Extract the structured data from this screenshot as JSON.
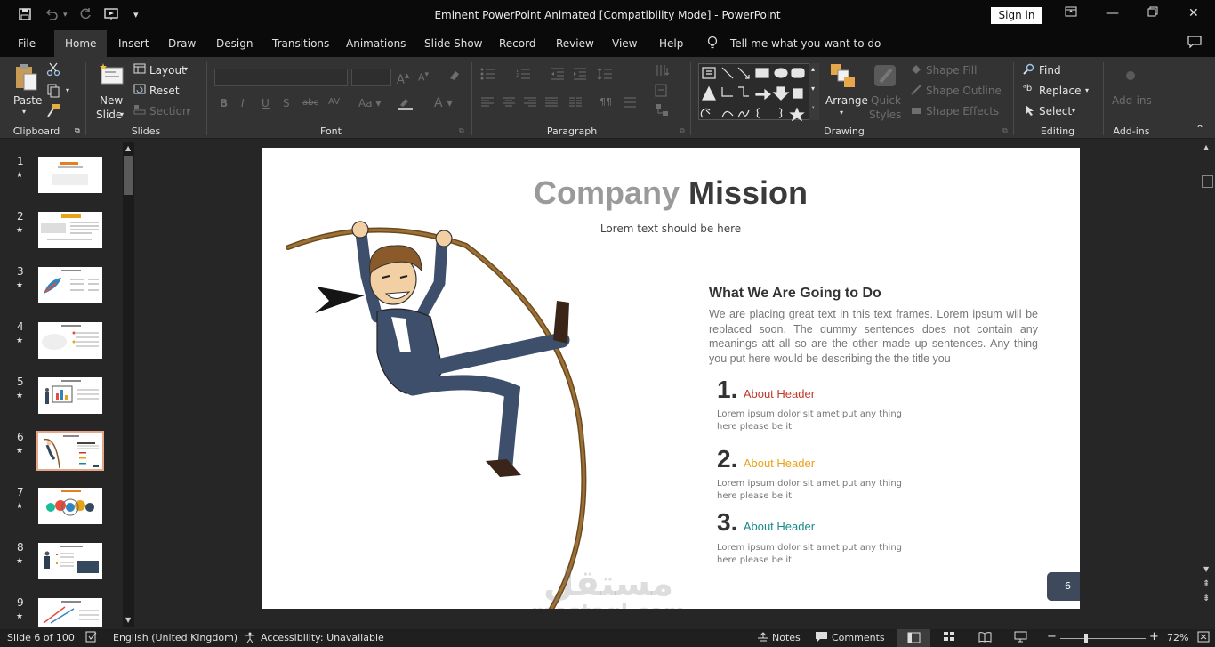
{
  "window": {
    "title": "Eminent PowerPoint Animated [Compatibility Mode]  -  PowerPoint",
    "sign_in": "Sign in"
  },
  "tabs": [
    {
      "label": "File"
    },
    {
      "label": "Home"
    },
    {
      "label": "Insert"
    },
    {
      "label": "Draw"
    },
    {
      "label": "Design"
    },
    {
      "label": "Transitions"
    },
    {
      "label": "Animations"
    },
    {
      "label": "Slide Show"
    },
    {
      "label": "Record"
    },
    {
      "label": "Review"
    },
    {
      "label": "View"
    },
    {
      "label": "Help"
    }
  ],
  "tell_me": "Tell me what you want to do",
  "ribbon": {
    "clipboard": {
      "label": "Clipboard",
      "paste": "Paste"
    },
    "slides": {
      "label": "Slides",
      "new_slide_1": "New",
      "new_slide_2": "Slide",
      "layout": "Layout",
      "reset": "Reset",
      "section": "Section"
    },
    "font": {
      "label": "Font"
    },
    "paragraph": {
      "label": "Paragraph"
    },
    "drawing": {
      "label": "Drawing",
      "arrange": "Arrange",
      "quick_styles_1": "Quick",
      "quick_styles_2": "Styles",
      "shape_fill": "Shape Fill",
      "shape_outline": "Shape Outline",
      "shape_effects": "Shape Effects"
    },
    "editing": {
      "label": "Editing",
      "find": "Find",
      "replace": "Replace",
      "select": "Select"
    },
    "addins": {
      "label": "Add-ins",
      "addins_btn": "Add-ins"
    }
  },
  "thumbnails": [
    {
      "num": "1"
    },
    {
      "num": "2"
    },
    {
      "num": "3"
    },
    {
      "num": "4"
    },
    {
      "num": "5"
    },
    {
      "num": "6"
    },
    {
      "num": "7"
    },
    {
      "num": "8"
    },
    {
      "num": "9"
    }
  ],
  "slide": {
    "title_light": "Company",
    "title_bold": "Mission",
    "subtitle": "Lorem text should be here",
    "section_heading": "What We Are Going to Do",
    "section_body": "We are placing great text in this text frames. Lorem ipsum will be replaced soon. The dummy sentences does not contain any meanings att all so are the other made up sentences. Any thing you put here would be describing the the title you",
    "items": [
      {
        "num": "1.",
        "header": "About Header",
        "color": "#c0392b",
        "body_1": "Lorem ipsum dolor sit amet put any thing",
        "body_2": "here please be it"
      },
      {
        "num": "2.",
        "header": "About Header",
        "color": "#e8a317",
        "body_1": "Lorem ipsum dolor sit amet put any thing",
        "body_2": "here please be it"
      },
      {
        "num": "3.",
        "header": "About Header",
        "color": "#1a8a8a",
        "body_1": "Lorem ipsum dolor sit amet put any thing",
        "body_2": "here please be it"
      }
    ],
    "page_number": "6"
  },
  "watermark": {
    "arabic": "مستقل",
    "latin": "mostaql.com"
  },
  "status": {
    "slide_of": "Slide 6 of 100",
    "language": "English (United Kingdom)",
    "accessibility": "Accessibility: Unavailable",
    "notes": "Notes",
    "comments": "Comments",
    "zoom": "72%"
  }
}
